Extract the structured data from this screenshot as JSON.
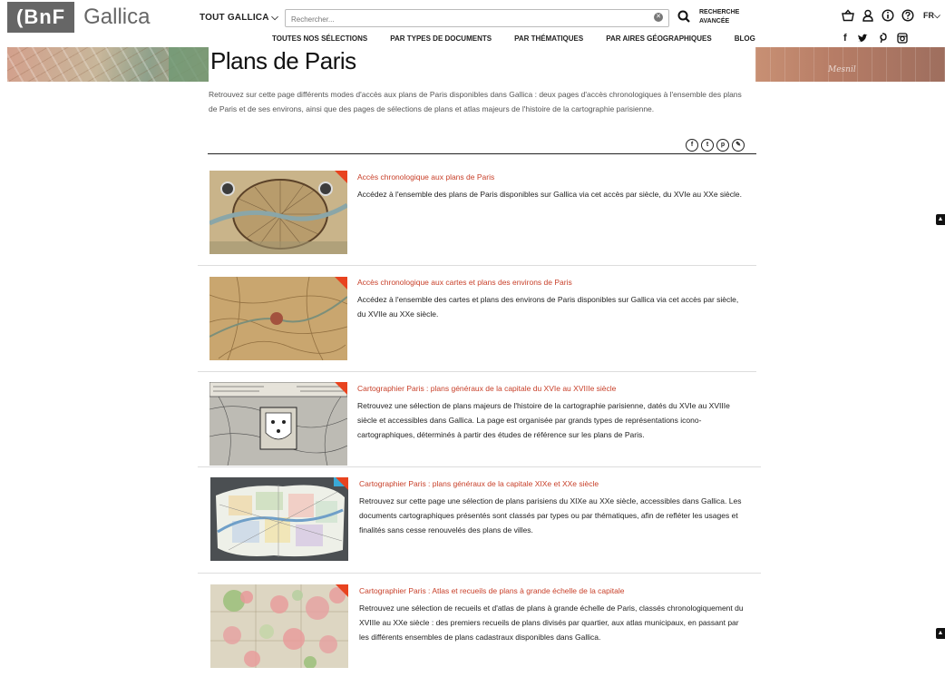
{
  "header": {
    "logo_bnf": "(BnF",
    "logo_gallica": "Gallica",
    "scope_label": "TOUT GALLICA",
    "search_placeholder": "Rechercher...",
    "advanced_line1": "RECHERCHE",
    "advanced_line2": "AVANCÉE",
    "lang": "FR"
  },
  "nav": {
    "items": [
      "TOUTES NOS SÉLECTIONS",
      "PAR TYPES DE DOCUMENTS",
      "PAR THÉMATIQUES",
      "PAR AIRES GÉOGRAPHIQUES",
      "BLOG"
    ]
  },
  "banner": {
    "right_text": "Mesnil"
  },
  "page": {
    "title": "Plans de Paris",
    "intro": "Retrouvez sur cette page différents modes d'accès aux plans de Paris disponibles dans Gallica : deux pages d'accès chronologiques à l'ensemble des plans de Paris et de ses environs, ainsi que des pages de sélections de plans et atlas majeurs de l'histoire de la cartographie parisienne."
  },
  "items": [
    {
      "title": "Accès chronologique aux plans de Paris",
      "desc": "Accédez à l'ensemble des plans de Paris disponibles sur Gallica via cet accès par siècle, du XVIe au XXe siècle."
    },
    {
      "title": "Accès chronologique aux cartes et plans des environs de Paris",
      "desc": "Accédez à l'ensemble des cartes et plans des environs de Paris disponibles sur Gallica via cet accès par siècle, du XVIIe au XXe siècle."
    },
    {
      "title": "Cartographier Paris : plans généraux de la capitale du XVIe au XVIIIe siècle",
      "desc": "Retrouvez une sélection de plans majeurs de l'histoire de la cartographie parisienne, datés du XVIe au XVIIIe siècle et accessibles dans Gallica. La page est organisée par grands types de représentations icono-cartographiques, déterminés à partir des études de référence sur les plans de Paris."
    },
    {
      "title": "Cartographier Paris : plans généraux de la capitale XIXe et XXe siècle",
      "desc": "Retrouvez sur cette page une sélection de plans parisiens du XIXe au XXe siècle, accessibles dans Gallica. Les documents cartographiques présentés sont classés par types ou par thématiques, afin de refléter les usages et finalités sans cesse renouvelés des plans de villes."
    },
    {
      "title": "Cartographier Paris : Atlas et recueils de plans à grande échelle de la capitale",
      "desc": "Retrouvez une sélection de recueils et d'atlas de plans à grande échelle de Paris, classés chronologiquement du XVIIIe au XXe siècle : des premiers recueils de plans divisés par quartier, aux atlas municipaux, en passant par les différents ensembles de plans cadastraux disponibles dans Gallica."
    }
  ],
  "colors": {
    "accent": "#c8402a",
    "corner": "#e8431f",
    "logo_bg": "#666666"
  }
}
